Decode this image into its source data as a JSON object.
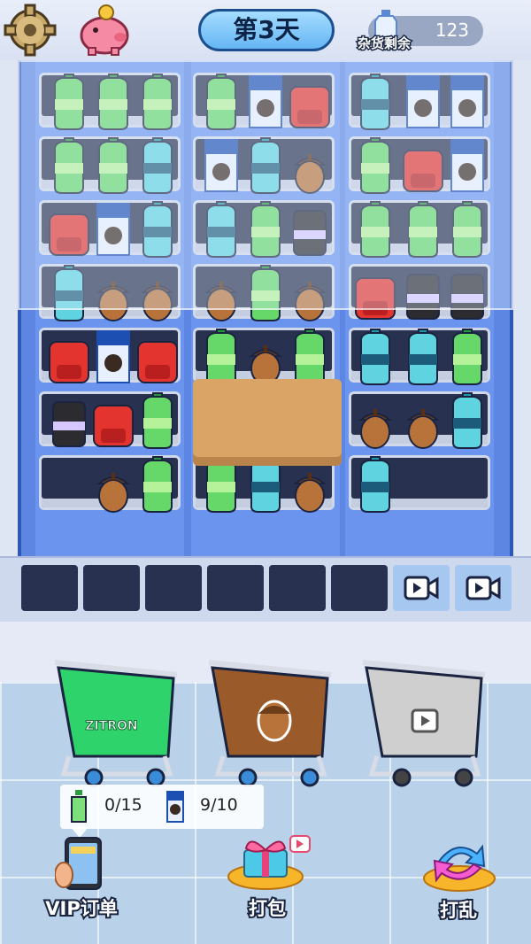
{
  "header": {
    "day_label": "第3天",
    "stock_label": "杂货剩余",
    "stock_count": "123"
  },
  "colors": {
    "shelf": "#5d86e3",
    "slot": "#28314f",
    "green_cart": "#2fd36b",
    "brown_cart": "#9b5a2a",
    "gray_cart": "#cfcfcf",
    "day_pill": "#7cc4f8"
  },
  "items": {
    "green_bottle_label": "ZITRON",
    "backpack_label": ""
  },
  "order": {
    "green_progress": "0/15",
    "cookie_progress": "9/10"
  },
  "buttons": {
    "vip": "VIP订单",
    "pack": "打包",
    "shuffle": "打乱"
  },
  "icons": [
    "gear-icon",
    "piggy-bank-icon",
    "water-bottle-icon",
    "video-ad-icon",
    "phone-icon",
    "gift-box-icon",
    "shuffle-icon",
    "acorn-icon"
  ]
}
